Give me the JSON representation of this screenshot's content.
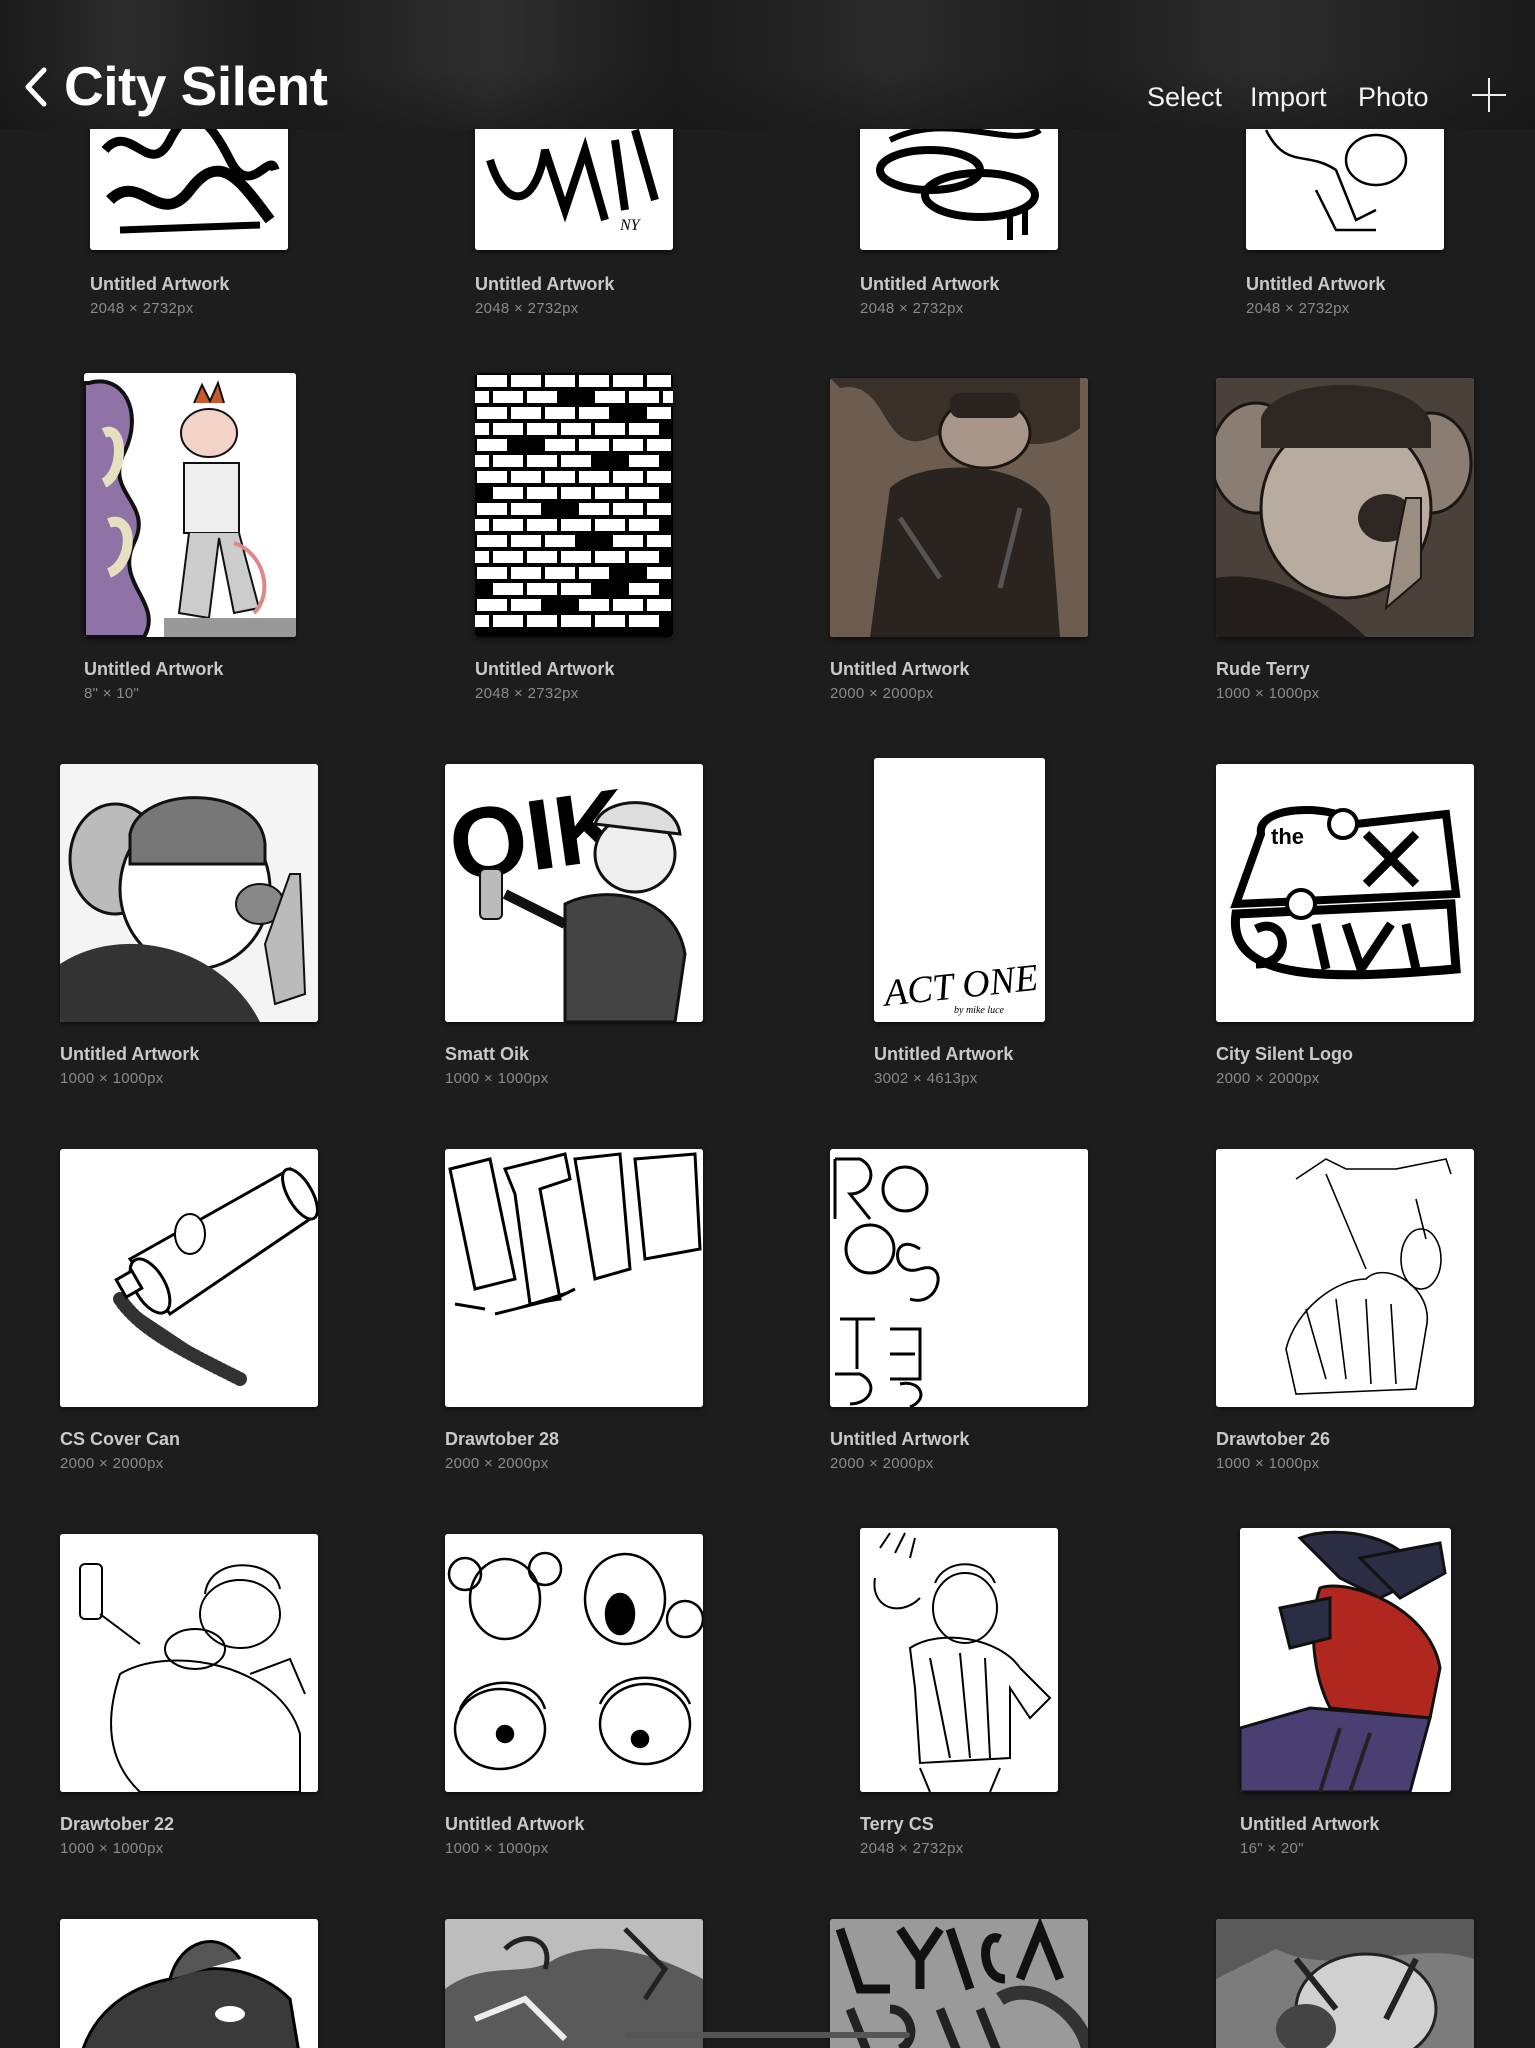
{
  "header": {
    "title": "City Silent",
    "back_icon": "chevron-left-icon",
    "actions": {
      "select": "Select",
      "import": "Import",
      "photo": "Photo"
    },
    "add_icon": "plus-icon"
  },
  "artworks": [
    {
      "name": "Untitled Artwork",
      "size": "2048 × 2732px",
      "thumb": "tag-graffiti-icon"
    },
    {
      "name": "Untitled Artwork",
      "size": "2048 × 2732px",
      "thumb": "tag-new-york-icon"
    },
    {
      "name": "Untitled Artwork",
      "size": "2048 × 2732px",
      "thumb": "tag-scribble-icon"
    },
    {
      "name": "Untitled Artwork",
      "size": "2048 × 2732px",
      "thumb": "character-sketch-icon"
    },
    {
      "name": "Untitled Artwork",
      "size": "8\" × 10\"",
      "thumb": "rooster-character-icon"
    },
    {
      "name": "Untitled Artwork",
      "size": "2048 × 2732px",
      "thumb": "brick-wall-icon"
    },
    {
      "name": "Untitled Artwork",
      "size": "2000 × 2000px",
      "thumb": "sepia-character-icon"
    },
    {
      "name": "Rude Terry",
      "size": "1000 × 1000px",
      "thumb": "rude-terry-icon"
    },
    {
      "name": "Untitled Artwork",
      "size": "1000 × 1000px",
      "thumb": "mouse-portrait-icon"
    },
    {
      "name": "Smatt Oik",
      "size": "1000 × 1000px",
      "thumb": "oik-mouse-icon"
    },
    {
      "name": "Untitled Artwork",
      "size": "3002 × 4613px",
      "thumb": "act-one-icon"
    },
    {
      "name": "City Silent Logo",
      "size": "2000 × 2000px",
      "thumb": "city-silent-logo-icon"
    },
    {
      "name": "CS Cover Can",
      "size": "2000 × 2000px",
      "thumb": "spray-can-icon"
    },
    {
      "name": "Drawtober 28",
      "size": "2000 × 2000px",
      "thumb": "lettering-sketch-icon"
    },
    {
      "name": "Untitled Artwork",
      "size": "2000 × 2000px",
      "thumb": "rooster-letters-icon"
    },
    {
      "name": "Drawtober 26",
      "size": "1000 × 1000px",
      "thumb": "figure-sketch-icon"
    },
    {
      "name": "Drawtober 22",
      "size": "1000 × 1000px",
      "thumb": "spray-mouse-icon"
    },
    {
      "name": "Untitled Artwork",
      "size": "1000 × 1000px",
      "thumb": "mouse-heads-icon"
    },
    {
      "name": "Terry CS",
      "size": "2048 × 2732px",
      "thumb": "terry-sketch-icon"
    },
    {
      "name": "Untitled Artwork",
      "size": "16\" × 20\"",
      "thumb": "red-jacket-icon"
    },
    {
      "name": "",
      "size": "",
      "thumb": "rat-head-icon"
    },
    {
      "name": "",
      "size": "",
      "thumb": "hands-grey-icon"
    },
    {
      "name": "",
      "size": "",
      "thumb": "lyrical-grey-icon"
    },
    {
      "name": "",
      "size": "",
      "thumb": "character-grey-icon"
    }
  ]
}
